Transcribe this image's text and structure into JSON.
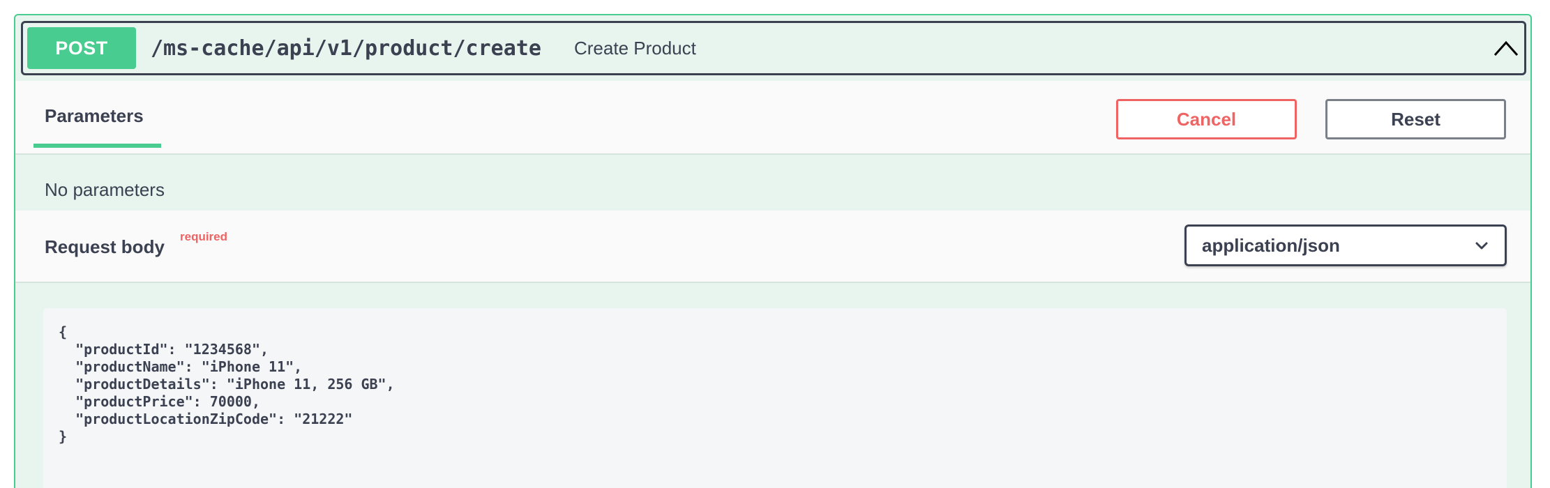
{
  "operation": {
    "method": "POST",
    "path": "/ms-cache/api/v1/product/create",
    "summary": "Create Product"
  },
  "tabs": {
    "parameters_label": "Parameters"
  },
  "buttons": {
    "cancel_label": "Cancel",
    "reset_label": "Reset"
  },
  "parameters": {
    "empty_text": "No parameters"
  },
  "request_body": {
    "title": "Request body",
    "required_label": "required",
    "content_type": "application/json",
    "example": "{\n  \"productId\": \"1234568\",\n  \"productName\": \"iPhone 11\",\n  \"productDetails\": \"iPhone 11, 256 GB\",\n  \"productPrice\": 70000,\n  \"productLocationZipCode\": \"21222\"\n}"
  },
  "icons": {
    "collapse": "chevron-up-icon",
    "select": "chevron-down-icon"
  },
  "colors": {
    "post_green": "#49cc90",
    "post_background": "#e8f5ee",
    "cancel_red": "#f06363",
    "text_dark": "#3b4151"
  }
}
